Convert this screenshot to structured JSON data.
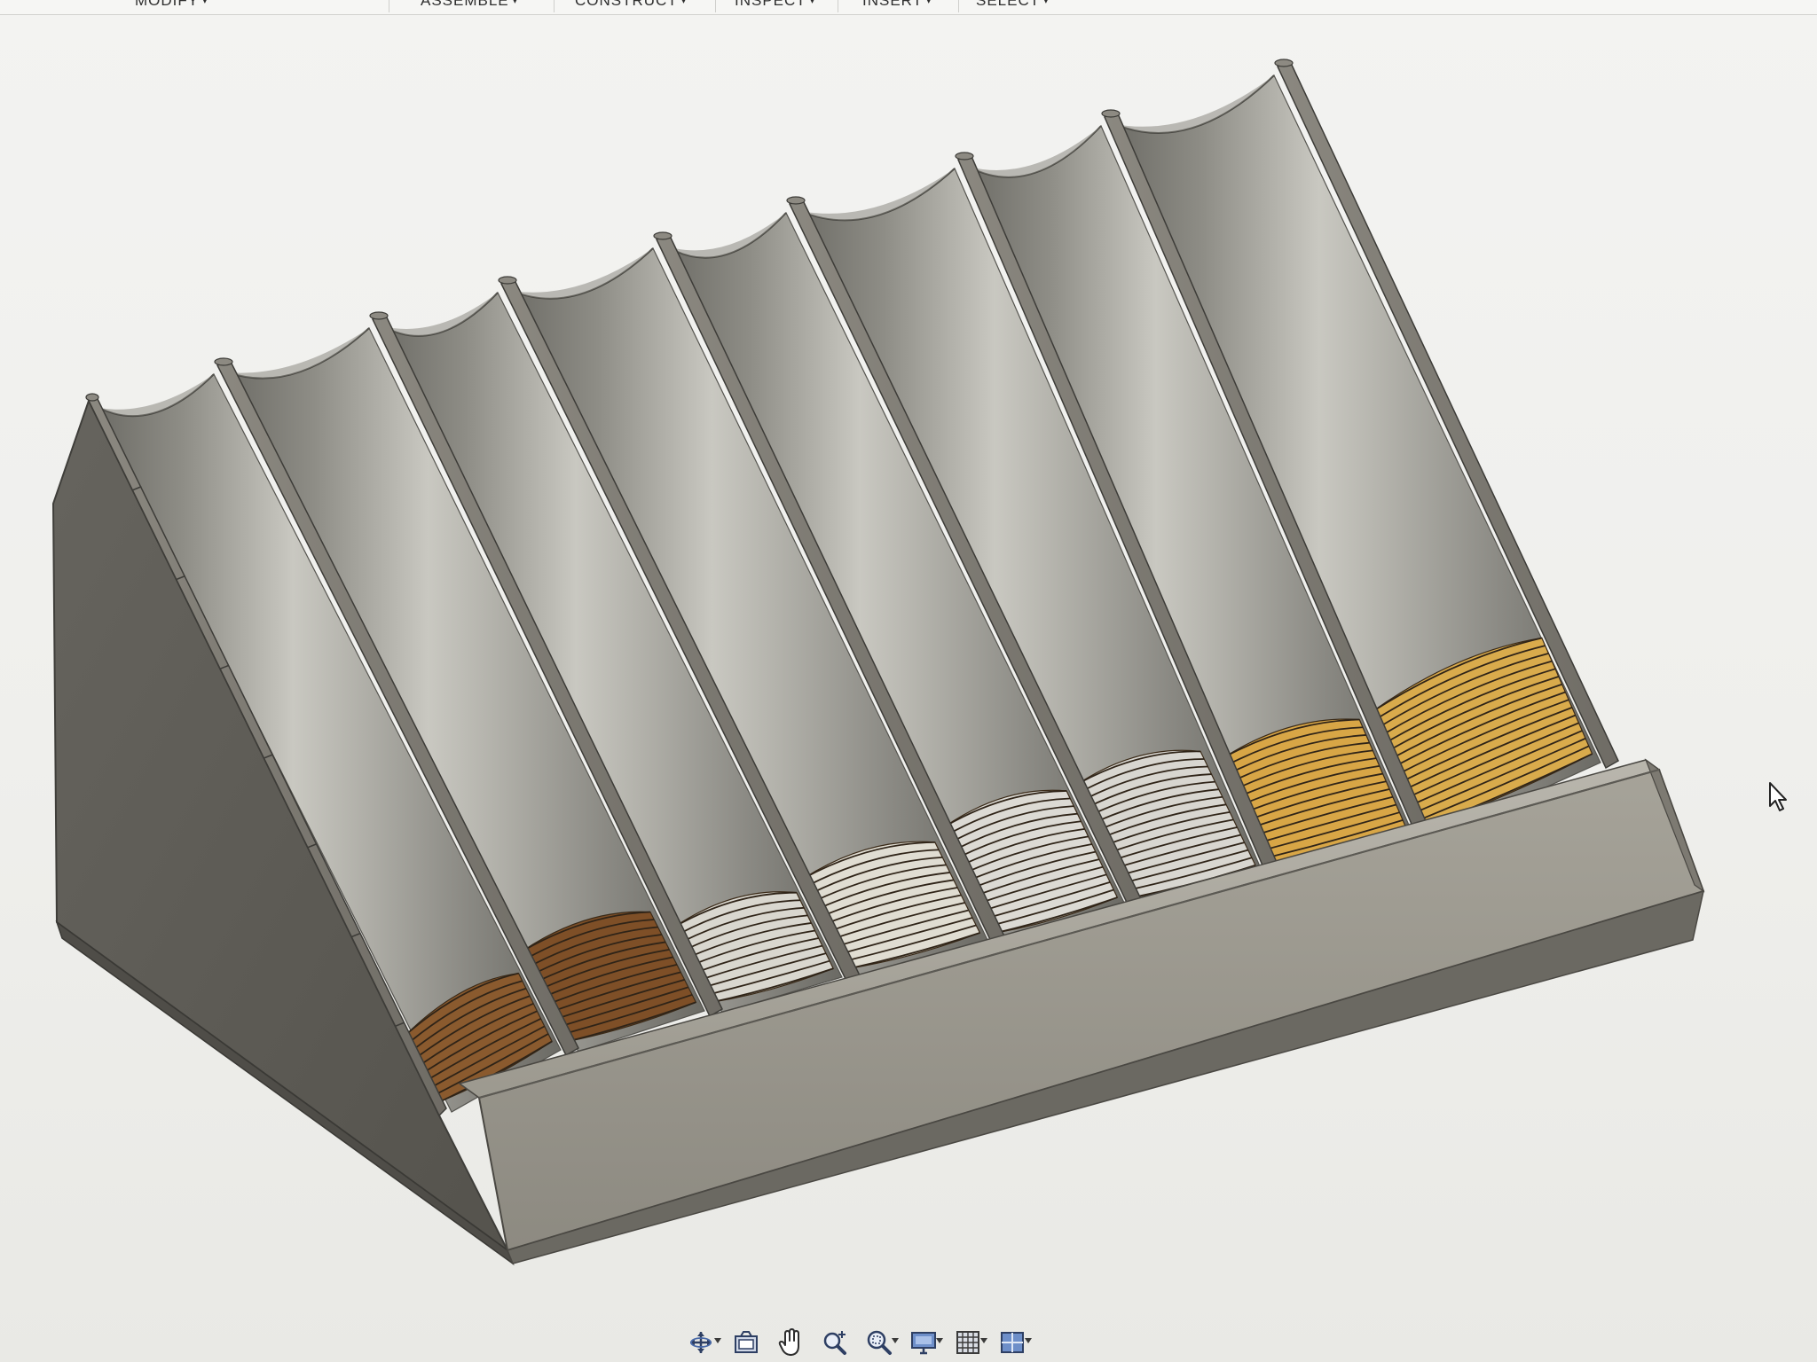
{
  "app": {
    "toolbar": {
      "items": [
        {
          "label": "MODIFY",
          "has_dropdown": true
        },
        {
          "label": "ASSEMBLE",
          "has_dropdown": true
        },
        {
          "label": "CONSTRUCT",
          "has_dropdown": true
        },
        {
          "label": "INSPECT",
          "has_dropdown": true
        },
        {
          "label": "INSERT",
          "has_dropdown": true
        },
        {
          "label": "SELECT",
          "has_dropdown": true
        }
      ]
    },
    "viewport": {
      "model": "coin-sorter-tray",
      "slot_count": 8,
      "slots": [
        {
          "coin_color": "#8a5a2e",
          "coins_visible": 9
        },
        {
          "coin_color": "#7e4f27",
          "coins_visible": 12
        },
        {
          "coin_color": "#d9d7cf",
          "coins_visible": 10
        },
        {
          "coin_color": "#e0ddd2",
          "coins_visible": 12
        },
        {
          "coin_color": "#dcdad4",
          "coins_visible": 14
        },
        {
          "coin_color": "#d8d6d0",
          "coins_visible": 15
        },
        {
          "coin_color": "#d8a646",
          "coins_visible": 14
        },
        {
          "coin_color": "#d9ab4c",
          "coins_visible": 15
        }
      ],
      "colors": {
        "tray_body": "#7b7870",
        "tray_side": "#5a5852",
        "tray_front_lip": "#9a978e",
        "slot_trough": "#a9a8a1",
        "background": "#efefec"
      }
    },
    "navigation_bar": {
      "buttons": [
        {
          "icon": "orbit-icon",
          "has_dropdown": true
        },
        {
          "icon": "look-at-icon",
          "has_dropdown": false
        },
        {
          "icon": "pan-hand-icon",
          "has_dropdown": false
        },
        {
          "icon": "zoom-icon",
          "has_dropdown": false
        },
        {
          "icon": "fit-zoom-icon",
          "has_dropdown": true
        },
        {
          "icon": "display-settings-icon",
          "has_dropdown": true
        },
        {
          "icon": "grid-snaps-icon",
          "has_dropdown": true
        },
        {
          "icon": "viewports-icon",
          "has_dropdown": true
        }
      ]
    }
  }
}
